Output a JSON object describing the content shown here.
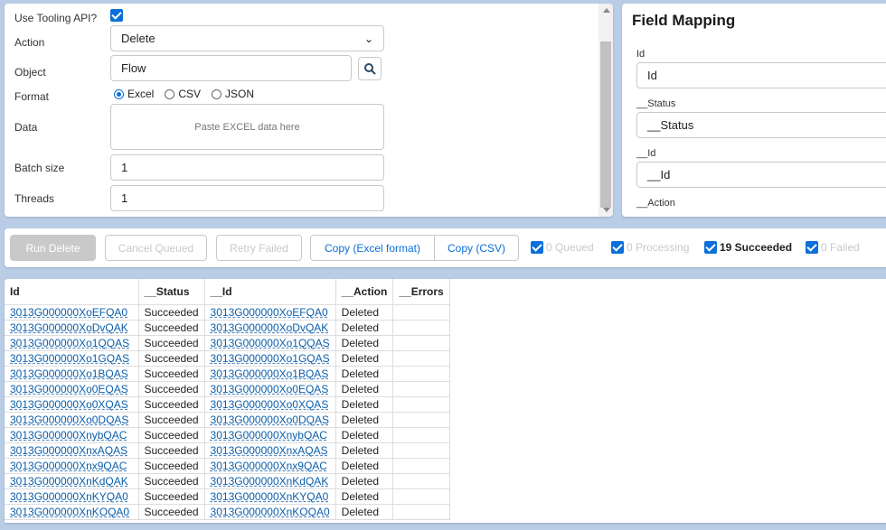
{
  "form": {
    "use_tooling_label": "Use Tooling API?",
    "action_label": "Action",
    "action_value": "Delete",
    "object_label": "Object",
    "object_value": "Flow",
    "format_label": "Format",
    "format_options": [
      "Excel",
      "CSV",
      "JSON"
    ],
    "format_selected": "Excel",
    "data_label": "Data",
    "data_placeholder": "Paste EXCEL data here",
    "batch_label": "Batch size",
    "batch_value": "1",
    "threads_label": "Threads",
    "threads_value": "1"
  },
  "mapping": {
    "title": "Field Mapping",
    "fields": [
      {
        "label": "Id",
        "value": "Id"
      },
      {
        "label": "__Status",
        "value": "__Status"
      },
      {
        "label": "__Id",
        "value": "__Id"
      },
      {
        "label": "__Action",
        "value": ""
      }
    ]
  },
  "toolbar": {
    "run": "Run Delete",
    "cancel": "Cancel Queued",
    "retry": "Retry Failed",
    "copy_excel": "Copy (Excel format)",
    "copy_csv": "Copy (CSV)",
    "queued": "0 Queued",
    "processing": "0 Processing",
    "succeeded": "19 Succeeded",
    "failed": "0 Failed"
  },
  "table": {
    "headers": [
      "Id",
      "__Status",
      "__Id",
      "__Action",
      "__Errors"
    ],
    "rows": [
      [
        "3013G000000XoEFQA0",
        "Succeeded",
        "3013G000000XoEFQA0",
        "Deleted",
        ""
      ],
      [
        "3013G000000XoDvQAK",
        "Succeeded",
        "3013G000000XoDvQAK",
        "Deleted",
        ""
      ],
      [
        "3013G000000Xo1QQAS",
        "Succeeded",
        "3013G000000Xo1QQAS",
        "Deleted",
        ""
      ],
      [
        "3013G000000Xo1GQAS",
        "Succeeded",
        "3013G000000Xo1GQAS",
        "Deleted",
        ""
      ],
      [
        "3013G000000Xo1BQAS",
        "Succeeded",
        "3013G000000Xo1BQAS",
        "Deleted",
        ""
      ],
      [
        "3013G000000Xo0EQAS",
        "Succeeded",
        "3013G000000Xo0EQAS",
        "Deleted",
        ""
      ],
      [
        "3013G000000Xo0XQAS",
        "Succeeded",
        "3013G000000Xo0XQAS",
        "Deleted",
        ""
      ],
      [
        "3013G000000Xo0DQAS",
        "Succeeded",
        "3013G000000Xo0DQAS",
        "Deleted",
        ""
      ],
      [
        "3013G000000XnybQAC",
        "Succeeded",
        "3013G000000XnybQAC",
        "Deleted",
        ""
      ],
      [
        "3013G000000XnxAQAS",
        "Succeeded",
        "3013G000000XnxAQAS",
        "Deleted",
        ""
      ],
      [
        "3013G000000Xnx9QAC",
        "Succeeded",
        "3013G000000Xnx9QAC",
        "Deleted",
        ""
      ],
      [
        "3013G000000XnKdQAK",
        "Succeeded",
        "3013G000000XnKdQAK",
        "Deleted",
        ""
      ],
      [
        "3013G000000XnKYQA0",
        "Succeeded",
        "3013G000000XnKYQA0",
        "Deleted",
        ""
      ],
      [
        "3013G000000XnKOQA0",
        "Succeeded",
        "3013G000000XnKOQA0",
        "Deleted",
        ""
      ]
    ]
  }
}
